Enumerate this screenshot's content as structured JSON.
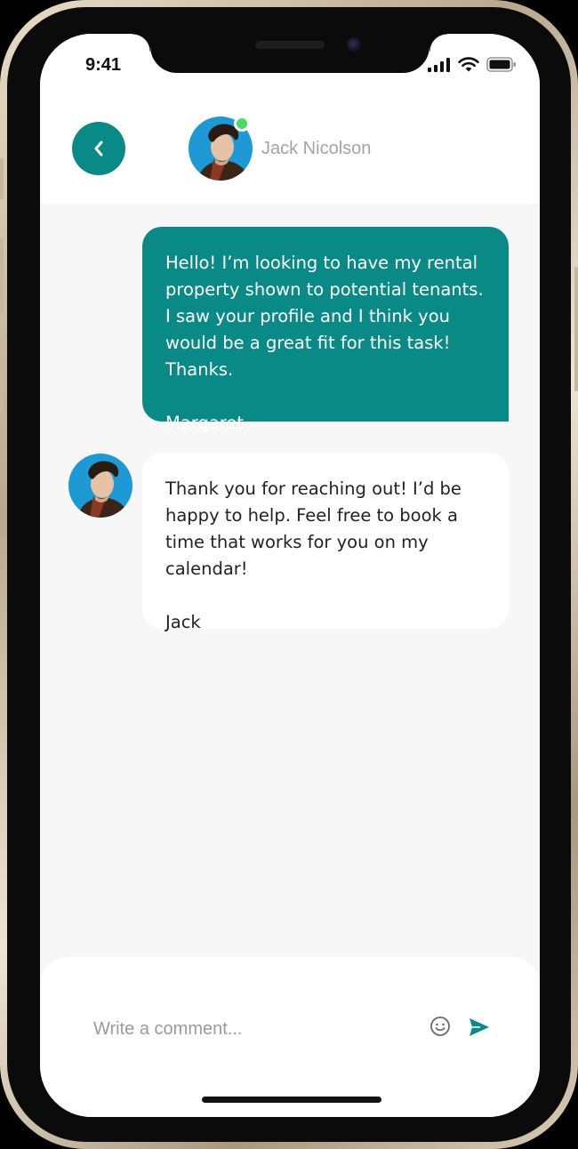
{
  "status_bar": {
    "time": "9:41",
    "icons": [
      "cellular-signal-icon",
      "wifi-icon",
      "battery-icon"
    ]
  },
  "header": {
    "back_icon": "chevron-left-icon",
    "contact_name": "Jack Nicolson",
    "online": true
  },
  "messages": [
    {
      "direction": "outgoing",
      "body": "Hello! I’m looking to have my rental property shown to potential tenants. I saw your profile and I think you would be a great fit for this task! Thanks.",
      "signature": "Margaret"
    },
    {
      "direction": "incoming",
      "body": "Thank you for reaching out! I’d be happy to help. Feel free to book a time that works for you on my calendar!",
      "signature": "Jack"
    }
  ],
  "composer": {
    "placeholder": "Write a comment...",
    "value": "",
    "emoji_icon": "emoji-smile-icon",
    "send_icon": "send-icon"
  },
  "colors": {
    "accent": "#0a8a87",
    "online": "#4cd964",
    "screen_bg": "#f7f7f7"
  }
}
